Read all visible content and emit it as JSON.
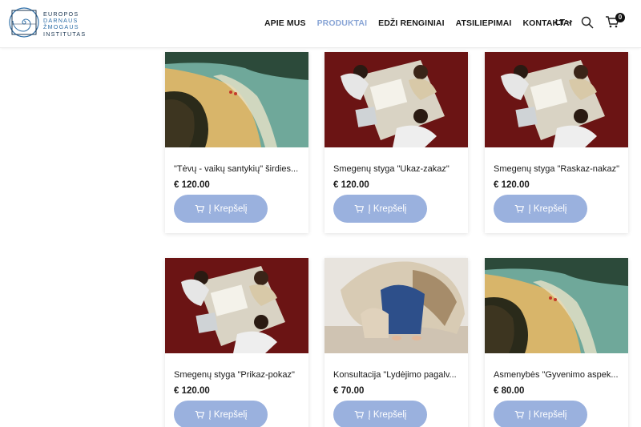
{
  "logo": {
    "line1": "EUROPOS",
    "line2": "DARNAUS",
    "line3": "ŽMOGAUS",
    "line4": "INSTITUTAS"
  },
  "nav": {
    "items": [
      {
        "label": "APIE MUS",
        "active": false
      },
      {
        "label": "PRODUKTAI",
        "active": true
      },
      {
        "label": "EDŽI RENGINIAI",
        "active": false
      },
      {
        "label": "ATSILIEPIMAI",
        "active": false
      },
      {
        "label": "KONTAKTAI",
        "active": false
      }
    ],
    "language": "LT"
  },
  "cart": {
    "count": "0"
  },
  "products": [
    {
      "title": "\"Tėvų - vaikų santykių\" širdies...",
      "price": "€ 120.00",
      "button": "Į Krepšelį",
      "image": "beach"
    },
    {
      "title": "Smegenų styga \"Ukaz-zakaz\"",
      "price": "€ 120.00",
      "button": "Į Krepšelį",
      "image": "meeting"
    },
    {
      "title": "Smegenų styga \"Raskaz-nakaz\"",
      "price": "€ 120.00",
      "button": "Į Krepšelį",
      "image": "meeting"
    },
    {
      "title": "Smegenų styga \"Prikaz-pokaz\"",
      "price": "€ 120.00",
      "button": "Į Krepšelį",
      "image": "meeting"
    },
    {
      "title": "Konsultacija \"Lydėjimo pagalv...",
      "price": "€ 70.00",
      "button": "Į Krepšelį",
      "image": "pillows"
    },
    {
      "title": "Asmenybės \"Gyvenimo aspek...",
      "price": "€ 80.00",
      "button": "Į Krepšelį",
      "image": "beach"
    }
  ],
  "colors": {
    "accent": "#9ab1de",
    "nav_active": "#8aa6d6",
    "text": "#1a1a1a"
  }
}
